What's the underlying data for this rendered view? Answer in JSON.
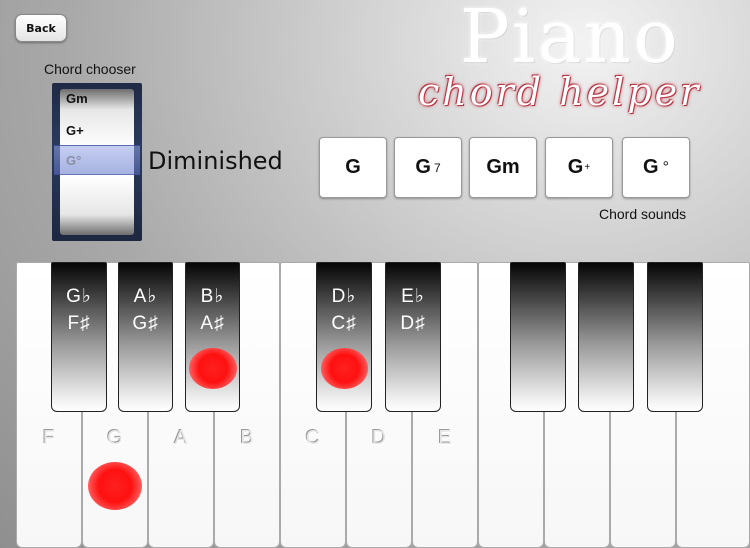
{
  "nav": {
    "back_label": "Back"
  },
  "title": {
    "main": "Piano",
    "sub": "chord helper"
  },
  "chooser": {
    "label": "Chord chooser",
    "items": [
      "Gm",
      "G+",
      "G°"
    ],
    "selected": "G°",
    "quality": "Diminished"
  },
  "chord_sounds": {
    "label": "Chord sounds",
    "buttons": [
      {
        "root": "G",
        "mod": ""
      },
      {
        "root": "G",
        "mod": "7"
      },
      {
        "root": "Gm",
        "mod": ""
      },
      {
        "root": "G",
        "mod": "+"
      },
      {
        "root": "G",
        "mod": "°"
      }
    ]
  },
  "keyboard": {
    "white_keys": [
      "F",
      "G",
      "A",
      "B",
      "C",
      "D",
      "E",
      "",
      "",
      "",
      ""
    ],
    "black_keys": [
      {
        "flat": "G♭",
        "sharp": "F♯"
      },
      {
        "flat": "A♭",
        "sharp": "G♯"
      },
      {
        "flat": "B♭",
        "sharp": "A♯"
      },
      {
        "flat": "D♭",
        "sharp": "C♯"
      },
      {
        "flat": "E♭",
        "sharp": "D♯"
      },
      {
        "flat": "",
        "sharp": ""
      },
      {
        "flat": "",
        "sharp": ""
      },
      {
        "flat": "",
        "sharp": ""
      }
    ],
    "highlighted_notes": [
      "G",
      "B♭",
      "D♭"
    ],
    "highlight_color": "#ff1a1a"
  }
}
